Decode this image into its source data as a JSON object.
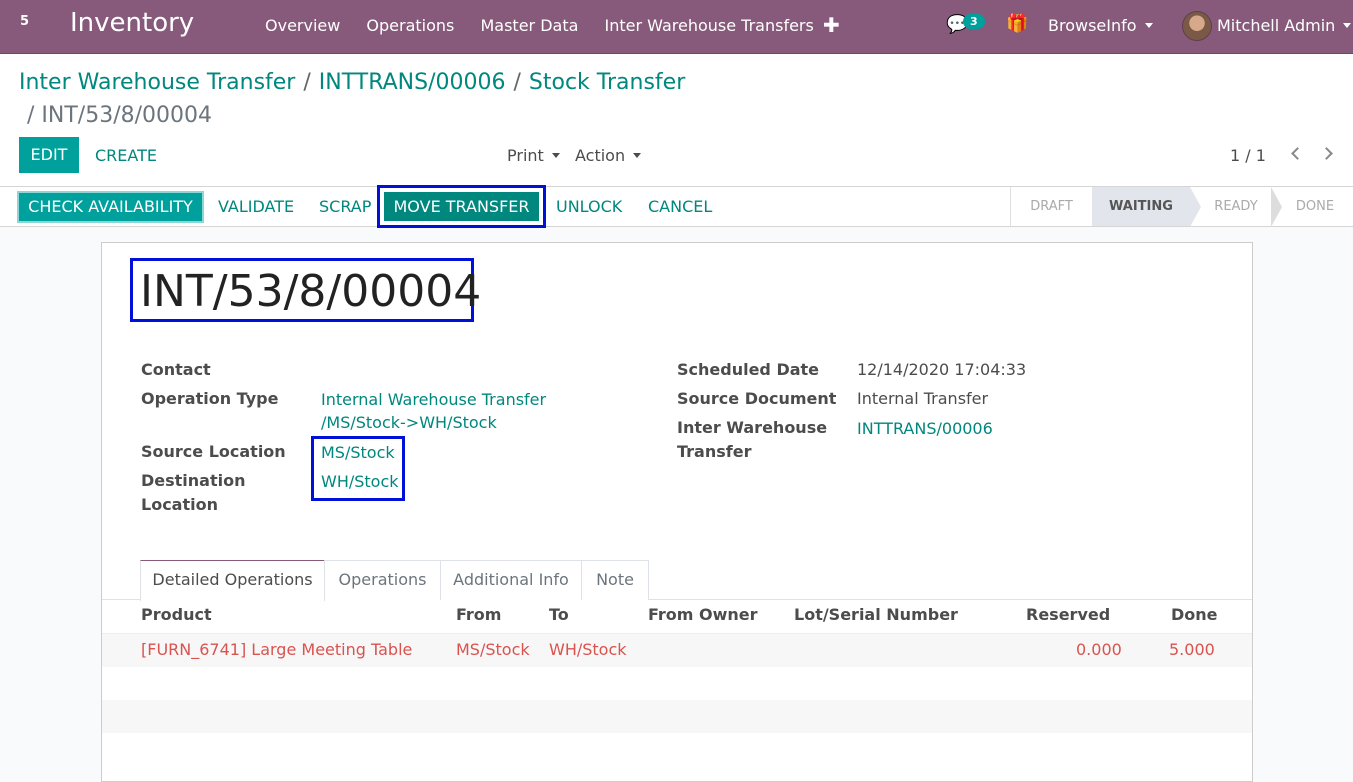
{
  "navbar": {
    "apps_label": "5",
    "brand": "Inventory",
    "menu": [
      "Overview",
      "Operations",
      "Master Data",
      "Inter Warehouse Transfers"
    ],
    "plus": "✚",
    "chat_icon": "💬",
    "chat_count": "3",
    "gift_icon": "🎁",
    "company": "BrowseInfo",
    "user": "Mitchell Admin"
  },
  "breadcrumb": {
    "items": [
      "Inter Warehouse Transfer",
      "INTTRANS/00006",
      "Stock Transfer"
    ],
    "separator": "/",
    "current": "INT/53/8/00004"
  },
  "buttons": {
    "edit": "EDIT",
    "create": "CREATE",
    "print": "Print",
    "action": "Action"
  },
  "pager": {
    "value": "1 / 1"
  },
  "statusbar": {
    "check_availability": "CHECK AVAILABILITY",
    "validate": "VALIDATE",
    "scrap": "SCRAP",
    "move_transfer": "MOVE TRANSFER",
    "unlock": "UNLOCK",
    "cancel": "CANCEL",
    "stages": [
      "DRAFT",
      "WAITING",
      "READY",
      "DONE"
    ],
    "current_stage": "WAITING"
  },
  "form": {
    "title": "INT/53/8/00004",
    "contact_label": "Contact",
    "operation_type_label": "Operation Type",
    "operation_type_line1": "Internal Warehouse Transfer",
    "operation_type_line2": "/MS/Stock->WH/Stock",
    "source_location_label": "Source Location",
    "source_location": "MS/Stock",
    "destination_location_label_1": "Destination",
    "destination_location_label_2": "Location",
    "destination_location": "WH/Stock",
    "scheduled_date_label": "Scheduled Date",
    "scheduled_date": "12/14/2020 17:04:33",
    "source_document_label": "Source Document",
    "source_document": "Internal Transfer",
    "iwt_label_1": "Inter Warehouse",
    "iwt_label_2": "Transfer",
    "iwt_value": "INTTRANS/00006"
  },
  "tabs": [
    "Detailed Operations",
    "Operations",
    "Additional Info",
    "Note"
  ],
  "table": {
    "headers": [
      "Product",
      "From",
      "To",
      "From Owner",
      "Lot/Serial Number",
      "Reserved",
      "Done"
    ],
    "rows": [
      {
        "product": "[FURN_6741] Large Meeting Table",
        "from": "MS/Stock",
        "to": "WH/Stock",
        "owner": "",
        "lot": "",
        "reserved": "0.000",
        "done": "5.000"
      }
    ]
  },
  "colors": {
    "navbar": "#875a7b",
    "primary": "#00a09d",
    "link": "#00877e",
    "highlight": "#0010d6",
    "danger_text": "#d9534f"
  }
}
